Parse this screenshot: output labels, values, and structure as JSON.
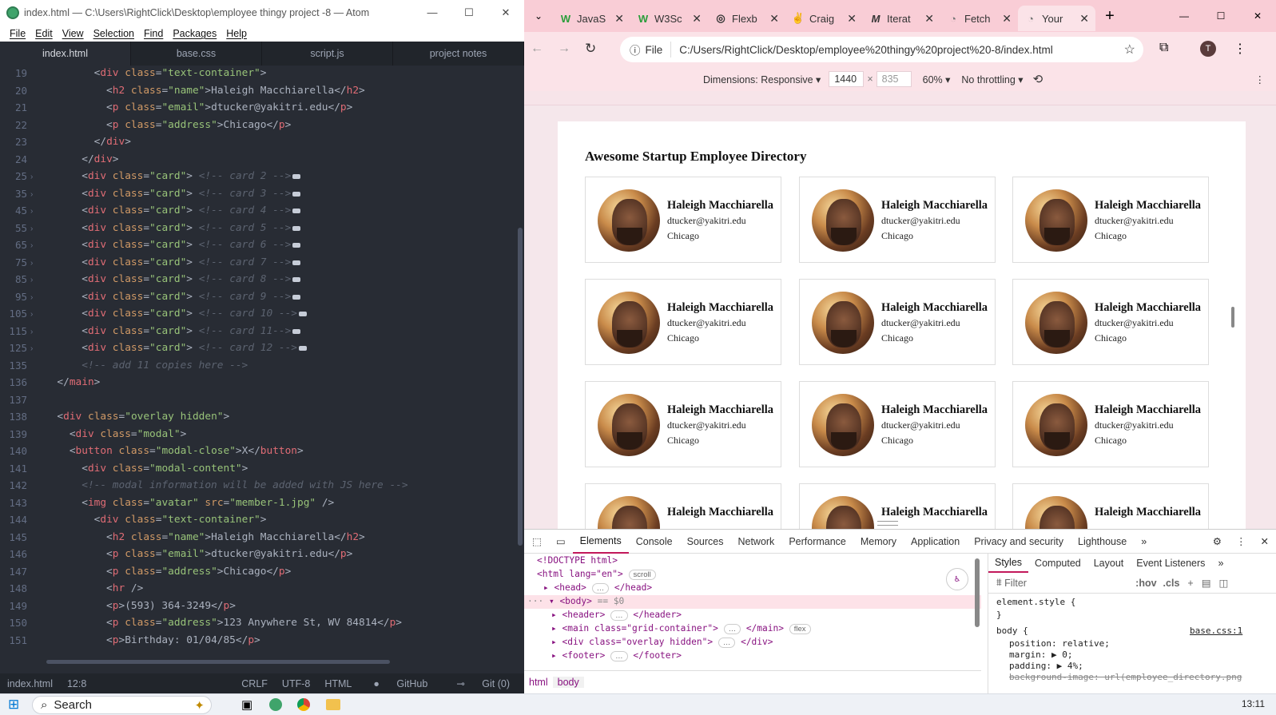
{
  "atom": {
    "title": "index.html — C:\\Users\\RightClick\\Desktop\\employee thingy project -8 — Atom",
    "menu": [
      "File",
      "Edit",
      "View",
      "Selection",
      "Find",
      "Packages",
      "Help"
    ],
    "tabs": [
      "index.html",
      "base.css",
      "script.js",
      "project notes"
    ],
    "line_numbers": [
      "19",
      "20",
      "21",
      "22",
      "23",
      "24",
      "25",
      "35",
      "45",
      "55",
      "65",
      "75",
      "85",
      "95",
      "105",
      "115",
      "125",
      "135",
      "136",
      "137",
      "138",
      "139",
      "140",
      "141",
      "142",
      "143",
      "144",
      "145",
      "146",
      "147",
      "148",
      "149",
      "150",
      "151"
    ],
    "status": {
      "file": "index.html",
      "cursor": "12:8",
      "eol": "CRLF",
      "encoding": "UTF-8",
      "grammar": "HTML",
      "github": "GitHub",
      "git": "Git (0)"
    }
  },
  "chrome": {
    "tabs": [
      {
        "label": "JavaS",
        "icon": "W"
      },
      {
        "label": "W3Sc",
        "icon": "W"
      },
      {
        "label": "Flexb",
        "icon": "◎"
      },
      {
        "label": "Craig",
        "icon": "✌"
      },
      {
        "label": "Iterat",
        "icon": "M"
      },
      {
        "label": "Fetch",
        "icon": "◔"
      },
      {
        "label": "Your",
        "icon": "◔"
      }
    ],
    "url_chip": "File",
    "url": "C:/Users/RightClick/Desktop/employee%20thingy%20project%20-8/index.html",
    "profile_initial": "T",
    "devbar": {
      "dimensions_label": "Dimensions: Responsive",
      "width": "1440",
      "height": "835",
      "zoom": "60%",
      "throttle": "No throttling"
    },
    "page": {
      "title": "Awesome Startup Employee Directory",
      "cards": [
        {
          "name": "Haleigh Macchiarella",
          "email": "dtucker@yakitri.edu",
          "address": "Chicago"
        },
        {
          "name": "Haleigh Macchiarella",
          "email": "dtucker@yakitri.edu",
          "address": "Chicago"
        },
        {
          "name": "Haleigh Macchiarella",
          "email": "dtucker@yakitri.edu",
          "address": "Chicago"
        },
        {
          "name": "Haleigh Macchiarella",
          "email": "dtucker@yakitri.edu",
          "address": "Chicago"
        },
        {
          "name": "Haleigh Macchiarella",
          "email": "dtucker@yakitri.edu",
          "address": "Chicago"
        },
        {
          "name": "Haleigh Macchiarella",
          "email": "dtucker@yakitri.edu",
          "address": "Chicago"
        },
        {
          "name": "Haleigh Macchiarella",
          "email": "dtucker@yakitri.edu",
          "address": "Chicago"
        },
        {
          "name": "Haleigh Macchiarella",
          "email": "dtucker@yakitri.edu",
          "address": "Chicago"
        },
        {
          "name": "Haleigh Macchiarella",
          "email": "dtucker@yakitri.edu",
          "address": "Chicago"
        },
        {
          "name": "Haleigh Macchiarella",
          "email": "",
          "address": ""
        },
        {
          "name": "Haleigh Macchiarella",
          "email": "",
          "address": ""
        },
        {
          "name": "Haleigh Macchiarella",
          "email": "",
          "address": ""
        }
      ]
    },
    "devtools": {
      "tabs": [
        "Elements",
        "Console",
        "Sources",
        "Network",
        "Performance",
        "Memory",
        "Application",
        "Privacy and security",
        "Lighthouse"
      ],
      "more": "»",
      "dom": {
        "doctype": "<!DOCTYPE html>",
        "html_open": "<html lang=\"en\">",
        "scroll_pill": "scroll",
        "head": "<head>",
        "head_close": "</head>",
        "body": "<body>",
        "body_eq": "== $0",
        "header": "<header>",
        "header_close": "</header>",
        "main": "<main class=\"grid-container\">",
        "main_close": "</main>",
        "flex_pill": "flex",
        "overlay": "<div class=\"overlay hidden\">",
        "overlay_close": "</div>",
        "footer": "<footer>",
        "footer_close": "</footer>"
      },
      "crumbs": [
        "html",
        "body"
      ],
      "styles_tabs": [
        "Styles",
        "Computed",
        "Layout",
        "Event Listeners"
      ],
      "filter_placeholder": "Filter",
      "hov": ":hov",
      "cls": ".cls",
      "rules": {
        "element_style": "element.style {",
        "close": "}",
        "body_sel": "body {",
        "source": "base.css:1",
        "position": "position: relative;",
        "margin": "margin: ▶ 0;",
        "padding": "padding: ▶ 4%;",
        "bg": "background-image: url(employee_directory.png"
      }
    }
  },
  "taskbar": {
    "search": "Search",
    "clock": "13:11"
  }
}
